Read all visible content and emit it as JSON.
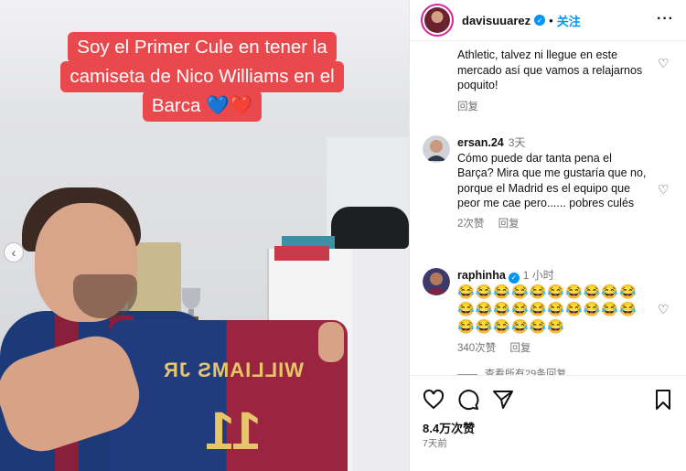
{
  "post": {
    "caption_lines": [
      "Soy el Primer Cule en tener la",
      "camiseta de Nico Williams en el",
      "Barca 💙❤️"
    ],
    "jersey_name": "WILLIAMS JR",
    "jersey_number": "11"
  },
  "header": {
    "username": "davisuuarez",
    "verified_mark": "✓",
    "separator": "•",
    "follow_label": "关注",
    "more_label": "···"
  },
  "comments": [
    {
      "username": "",
      "time": "",
      "text": "Athletic, talvez ni llegue en este mercado así que vamos a relajarnos poquito!",
      "likes": "",
      "reply_label": "回复"
    },
    {
      "username": "ersan.24",
      "time": "3天",
      "text": "Cómo puede dar tanta pena el Barça? Mira que me gustaría que no, porque el Madrid es el equipo que peor me cae pero...... pobres culés",
      "likes": "2次赞",
      "reply_label": "回复"
    },
    {
      "username": "raphinha",
      "verified_mark": "✓",
      "time": "1 小时",
      "emoji_lines": [
        "😂😂😂😂😂😂😂😂😂😂",
        "😂😂😂😂😂😂😂😂😂😂",
        "😂😂😂😂😂😂"
      ],
      "likes": "340次赞",
      "reply_label": "回复"
    }
  ],
  "view_all_label": "查看所有29条回复",
  "prev_label": "‹",
  "actions": {
    "like_icon": "heart-icon",
    "comment_icon": "comment-icon",
    "share_icon": "send-icon",
    "save_icon": "bookmark-icon",
    "likes_count": "8.4万次赞",
    "time_ago": "7天前"
  },
  "colors": {
    "caption_bg": "#e9494d",
    "link_blue": "#0095f6",
    "muted": "#737373"
  }
}
